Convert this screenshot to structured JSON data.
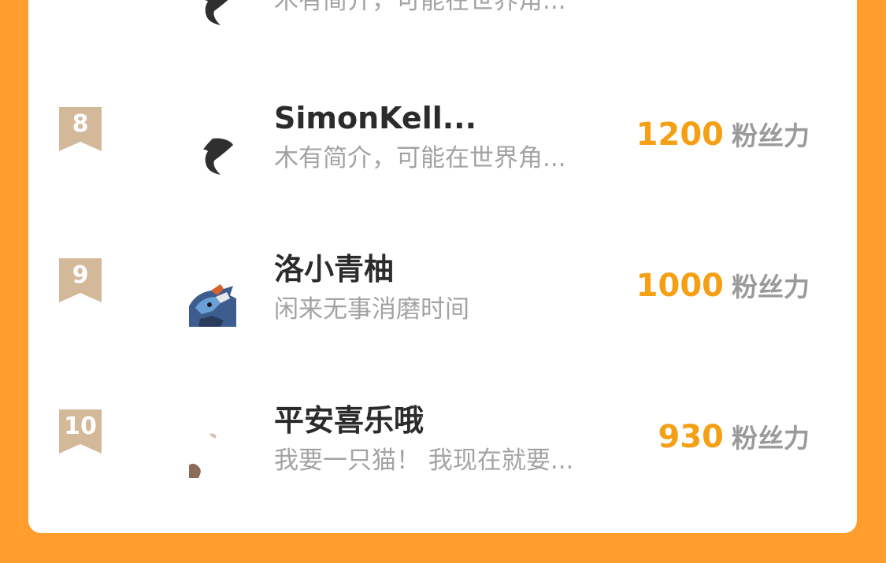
{
  "colors": {
    "background": "#FF9E2C",
    "card": "#FFFFFF",
    "accent_score": "#F5A014",
    "rank_badge": "#D4B89A"
  },
  "partial_top_row": {
    "description": "木有简介，可能在世界角..."
  },
  "rows": [
    {
      "rank": "8",
      "avatar_icon": "fish-silhouette-icon",
      "name": "SimonKell...",
      "description": "木有简介，可能在世界角...",
      "score": "1200",
      "unit": "粉丝力"
    },
    {
      "rank": "9",
      "avatar_icon": "cartoon-character-avatar",
      "name": "洛小青柚",
      "description": "闲来无事消磨时间",
      "score": "1000",
      "unit": "粉丝力"
    },
    {
      "rank": "10",
      "avatar_icon": "partial-photo-avatar",
      "name": "平安喜乐哦",
      "description": "我要一只猫！ 我现在就要...",
      "score": "930",
      "unit": "粉丝力"
    }
  ]
}
